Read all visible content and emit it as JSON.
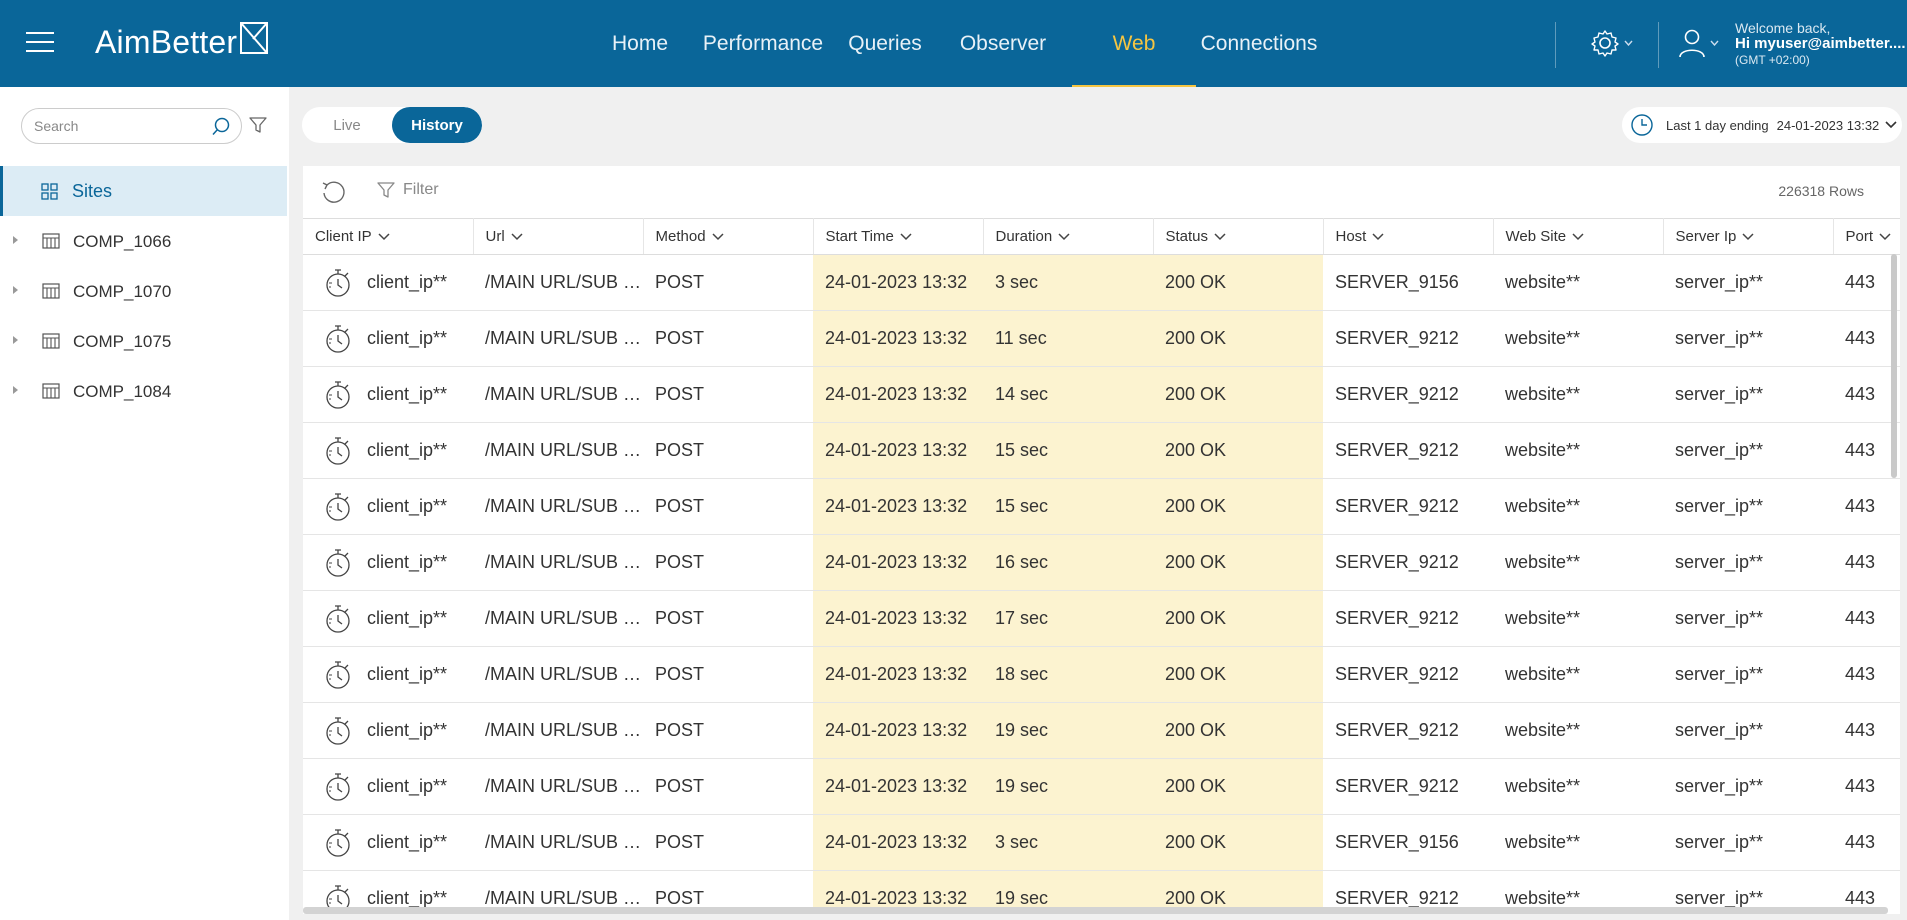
{
  "header": {
    "logo_text": "AimBetter",
    "nav": [
      {
        "label": "Home",
        "active": false
      },
      {
        "label": "Performance",
        "active": false
      },
      {
        "label": "Queries",
        "active": false
      },
      {
        "label": "Observer",
        "active": false
      },
      {
        "label": "Web",
        "active": true
      },
      {
        "label": "Connections",
        "active": false
      }
    ],
    "welcome_line1": "Welcome back,",
    "welcome_line2": "Hi myuser@aimbetter....",
    "timezone": "(GMT +02:00)"
  },
  "sidebar": {
    "search_placeholder": "Search",
    "sites_label": "Sites",
    "items": [
      "COMP_1066",
      "COMP_1070",
      "COMP_1075",
      "COMP_1084"
    ]
  },
  "mode_toggle": {
    "live_label": "Live",
    "history_label": "History",
    "selected": "History"
  },
  "date_range": {
    "label": "Last 1 day ending",
    "date": "24-01-2023 13:32"
  },
  "toolbar": {
    "filter_label": "Filter",
    "rows_count": "226318 Rows"
  },
  "table": {
    "columns": [
      "Client IP",
      "Url",
      "Method",
      "Start Time",
      "Duration",
      "Status",
      "Host",
      "Web Site",
      "Server Ip",
      "Port"
    ],
    "rows": [
      [
        "client_ip**",
        "/MAIN URL/SUB URL",
        "POST",
        "24-01-2023 13:32",
        "3 sec",
        "200 OK",
        "SERVER_9156",
        "website**",
        "server_ip**",
        "443"
      ],
      [
        "client_ip**",
        "/MAIN URL/SUB URL",
        "POST",
        "24-01-2023 13:32",
        "11 sec",
        "200 OK",
        "SERVER_9212",
        "website**",
        "server_ip**",
        "443"
      ],
      [
        "client_ip**",
        "/MAIN URL/SUB URL",
        "POST",
        "24-01-2023 13:32",
        "14 sec",
        "200 OK",
        "SERVER_9212",
        "website**",
        "server_ip**",
        "443"
      ],
      [
        "client_ip**",
        "/MAIN URL/SUB URL",
        "POST",
        "24-01-2023 13:32",
        "15 sec",
        "200 OK",
        "SERVER_9212",
        "website**",
        "server_ip**",
        "443"
      ],
      [
        "client_ip**",
        "/MAIN URL/SUB URL",
        "POST",
        "24-01-2023 13:32",
        "15 sec",
        "200 OK",
        "SERVER_9212",
        "website**",
        "server_ip**",
        "443"
      ],
      [
        "client_ip**",
        "/MAIN URL/SUB URL",
        "POST",
        "24-01-2023 13:32",
        "16 sec",
        "200 OK",
        "SERVER_9212",
        "website**",
        "server_ip**",
        "443"
      ],
      [
        "client_ip**",
        "/MAIN URL/SUB URL",
        "POST",
        "24-01-2023 13:32",
        "17 sec",
        "200 OK",
        "SERVER_9212",
        "website**",
        "server_ip**",
        "443"
      ],
      [
        "client_ip**",
        "/MAIN URL/SUB URL",
        "POST",
        "24-01-2023 13:32",
        "18 sec",
        "200 OK",
        "SERVER_9212",
        "website**",
        "server_ip**",
        "443"
      ],
      [
        "client_ip**",
        "/MAIN URL/SUB URL",
        "POST",
        "24-01-2023 13:32",
        "19 sec",
        "200 OK",
        "SERVER_9212",
        "website**",
        "server_ip**",
        "443"
      ],
      [
        "client_ip**",
        "/MAIN URL/SUB URL",
        "POST",
        "24-01-2023 13:32",
        "19 sec",
        "200 OK",
        "SERVER_9212",
        "website**",
        "server_ip**",
        "443"
      ],
      [
        "client_ip**",
        "/MAIN URL/SUB URL",
        "POST",
        "24-01-2023 13:32",
        "3 sec",
        "200 OK",
        "SERVER_9156",
        "website**",
        "server_ip**",
        "443"
      ],
      [
        "client_ip**",
        "/MAIN URL/SUB URL",
        "POST",
        "24-01-2023 13:32",
        "19 sec",
        "200 OK",
        "SERVER_9212",
        "website**",
        "server_ip**",
        "443"
      ]
    ]
  },
  "colors": {
    "brand": "#0a6699",
    "active_nav": "#f5c542",
    "highlight_column": "#fcf3d0"
  }
}
